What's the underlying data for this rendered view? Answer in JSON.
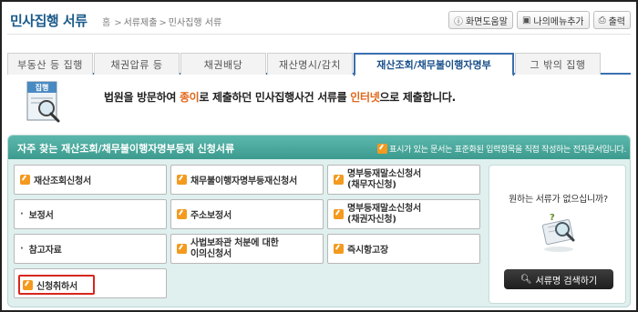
{
  "header": {
    "title": "민사집행 서류",
    "breadcrumb": [
      "홈",
      "서류제출",
      "민사집행 서류"
    ],
    "buttons": {
      "help": "화면도움말",
      "my_menu": "나의메뉴추가",
      "print": "출력"
    }
  },
  "tabs": [
    {
      "label": "부동산 등 집행",
      "active": false
    },
    {
      "label": "채권압류 등",
      "active": false
    },
    {
      "label": "채권배당",
      "active": false
    },
    {
      "label": "재산명시/감치",
      "active": false
    },
    {
      "label": "재산조회/채무불이행자명부",
      "active": true
    },
    {
      "label": "그 밖의 집행",
      "active": false
    }
  ],
  "intro": {
    "icon_label": "집행",
    "text_before": "법원을 방문하여 ",
    "highlight_paper": "종이",
    "text_middle": "로 제출하던 민사집행사건 서류를 ",
    "highlight_internet": "인터넷",
    "text_after": "으로 제출합니다."
  },
  "panel": {
    "title": "자주 찾는 재산조회/채무불이행자명부등재 신청서류",
    "note": "표시가 있는 문서는 표준화된 입력항목을 직접 작성하는 전자문서입니다.",
    "buttons": {
      "r1c1": "재산조회신청서",
      "r1c2": "채무불이행자명부등재신청서",
      "r1c3_line1": "명부등재말소신청서",
      "r1c3_line2": "(채무자신청)",
      "r2c1": "보정서",
      "r2c2": "주소보정서",
      "r2c3_line1": "명부등재말소신청서",
      "r2c3_line2": "(채권자신청)",
      "r3c1": "참고자료",
      "r3c2_line1": "사법보좌관 처분에 대한",
      "r3c2_line2": "이의신청서",
      "r3c3": "즉시항고장",
      "r4c1": "신청취하서"
    },
    "side": {
      "question": "원하는 서류가 없으십니까?",
      "search_button": "서류명 검색하기"
    }
  },
  "colors": {
    "accent_blue": "#3a6fb0",
    "panel_teal": "#3c9a8e",
    "highlight_orange": "#e0671a",
    "highlight_red_border": "#d7261e"
  }
}
